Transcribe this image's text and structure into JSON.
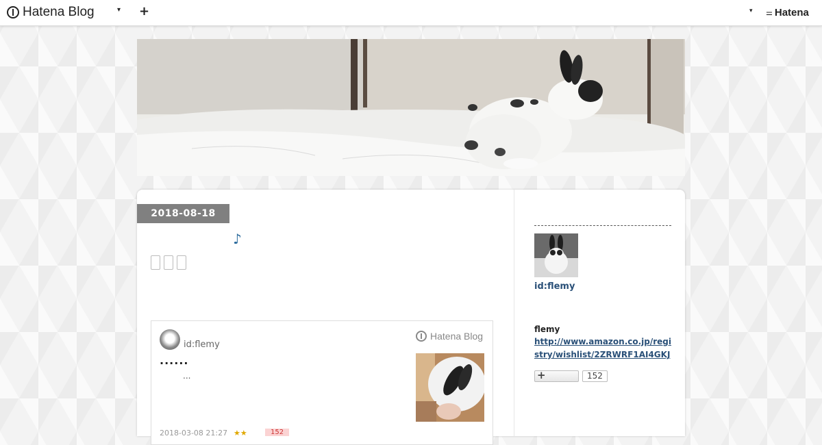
{
  "topbar": {
    "brand": "Hatena Blog",
    "menu_caret": "▾",
    "add_label": "+",
    "user_caret": "▾",
    "hatena_label": "Hatena"
  },
  "entry": {
    "date": "2018-08-18",
    "title": "♪",
    "buttons": [
      "□",
      "□",
      "□"
    ]
  },
  "embed": {
    "user": "id:flemy",
    "brand": "Hatena Blog",
    "title": "......",
    "excerpt": "...",
    "date": "2018-03-08 21:27",
    "stars": "★★",
    "count": "152"
  },
  "sidebar": {
    "id_label": "id:flemy",
    "name": "flemy",
    "link": "http://www.amazon.co.jp/registry/wishlist/2ZRWRF1AI4GKJ",
    "follow_plus": "+",
    "follow_count": "152"
  }
}
